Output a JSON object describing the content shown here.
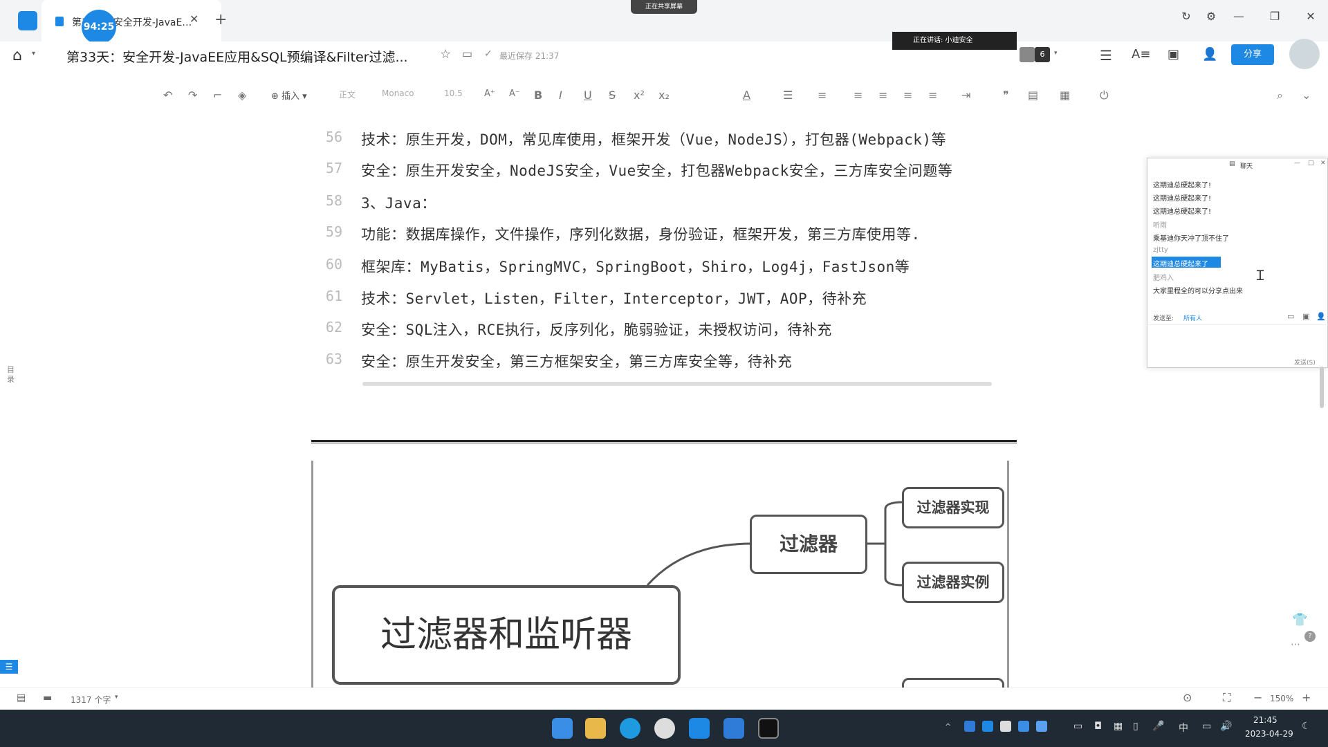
{
  "app": {
    "tab_title": "第33天：安全开发-JavaE…",
    "timer_badge": "94:25",
    "recording_chip": "正在共享屏幕",
    "speaker_chip": "正在讲话: 小迪安全",
    "participants_count": "6"
  },
  "header": {
    "doc_title": "第33天：安全开发-JavaEE应用&SQL预编译&Filter过滤...",
    "save_status": "最近保存 21:37",
    "share_label": "分享"
  },
  "toolbar": {
    "insert_label": "插入",
    "style_label": "正文",
    "font_label": "Monaco",
    "size_label": "10.5"
  },
  "document": {
    "lines": [
      {
        "num": "56",
        "text": "技术：原生开发，DOM，常见库使用，框架开发（Vue，NodeJS），打包器(Webpack)等"
      },
      {
        "num": "57",
        "text": "安全：原生开发安全，NodeJS安全，Vue安全，打包器Webpack安全，三方库安全问题等"
      },
      {
        "num": "58",
        "text": "3、Java："
      },
      {
        "num": "59",
        "text": "功能：数据库操作，文件操作，序列化数据，身份验证，框架开发，第三方库使用等."
      },
      {
        "num": "60",
        "text": "框架库：MyBatis，SpringMVC，SpringBoot，Shiro，Log4j，FastJson等"
      },
      {
        "num": "61",
        "text": "技术：Servlet，Listen，Filter，Interceptor，JWT，AOP，待补充"
      },
      {
        "num": "62",
        "text": "安全：SQL注入，RCE执行，反序列化，脆弱验证，未授权访问，待补充"
      },
      {
        "num": "63",
        "text": "安全：原生开发安全，第三方框架安全，第三方库安全等，待补充"
      }
    ],
    "outline_label": "目录",
    "mindmap": {
      "root": "过滤器和监听器",
      "branch": "过滤器",
      "leaf1": "过滤器实现",
      "leaf2": "过滤器实例"
    }
  },
  "chat": {
    "title": "聊天",
    "messages": [
      "这期迪总硬起来了!",
      "这期迪总硬起来了!",
      "这期迪总硬起来了!",
      "听雨",
      "乘基迪你天冲了顶不住了",
      "zjtty",
      "这期迪总硬起来了",
      "肥鸡入",
      "大家里程全的可以分享点出来"
    ],
    "send_to_label": "发送至:",
    "send_to_value": "所有人",
    "send_button": "发送(S)"
  },
  "statusbar": {
    "word_count": "1317 个字",
    "zoom": "150%"
  },
  "taskbar": {
    "time": "21:45",
    "date": "2023-04-29",
    "ime": "中"
  },
  "colors": {
    "accent": "#1e88e5",
    "taskbar": "#1f2a34",
    "chat_highlight": "#1e88e5"
  }
}
